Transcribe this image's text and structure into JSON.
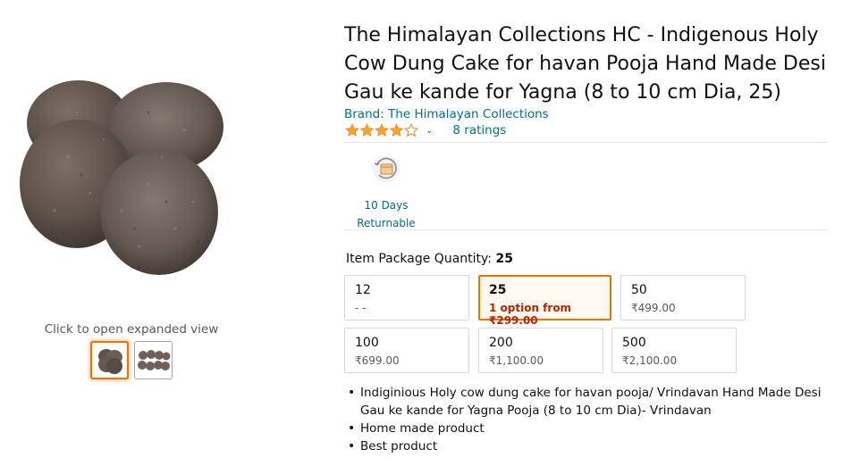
{
  "product": {
    "title": "The Himalayan Collections HC - Indigenous Holy Cow Dung Cake for havan Pooja Hand Made Desi Gau ke kande for Yagna (8 to 10 cm Dia, 25)",
    "brand": "Brand: The Himalayan Collections",
    "rating": 4.0,
    "ratings_count": "8 ratings",
    "star_color": "#ffa41c"
  },
  "gallery": {
    "caption": "Click to open expanded view",
    "thumbnails": [
      {
        "icon": "cow-dung-cake-single-image",
        "selected": true
      },
      {
        "icon": "cow-dung-cakes-group-image",
        "selected": false
      }
    ]
  },
  "returns": {
    "icon": "return-box-icon",
    "line1": "10 Days",
    "line2": "Returnable"
  },
  "quantity": {
    "label": "Item Package Quantity:",
    "selected": "25",
    "options": [
      {
        "qty": "12",
        "price": "- -",
        "selected": false
      },
      {
        "qty": "25",
        "price": "1 option from ₹299.00",
        "selected": true
      },
      {
        "qty": "50",
        "price": "₹499.00",
        "selected": false
      },
      {
        "qty": "100",
        "price": "₹699.00",
        "selected": false
      },
      {
        "qty": "200",
        "price": "₹1,100.00",
        "selected": false
      },
      {
        "qty": "500",
        "price": "₹2,100.00",
        "selected": false
      }
    ]
  },
  "bullets": [
    "Indiginious Holy cow dung cake for havan pooja/ Vrindavan Hand Made Desi Gau ke kande for Yagna Pooja (8 to 10 cm Dia)- Vrindavan",
    "Home made product",
    "Best product"
  ],
  "colors": {
    "link": "#007185",
    "accent_orange": "#e77600",
    "price_red": "#b12704",
    "text": "#0f1111",
    "muted": "#565959"
  }
}
